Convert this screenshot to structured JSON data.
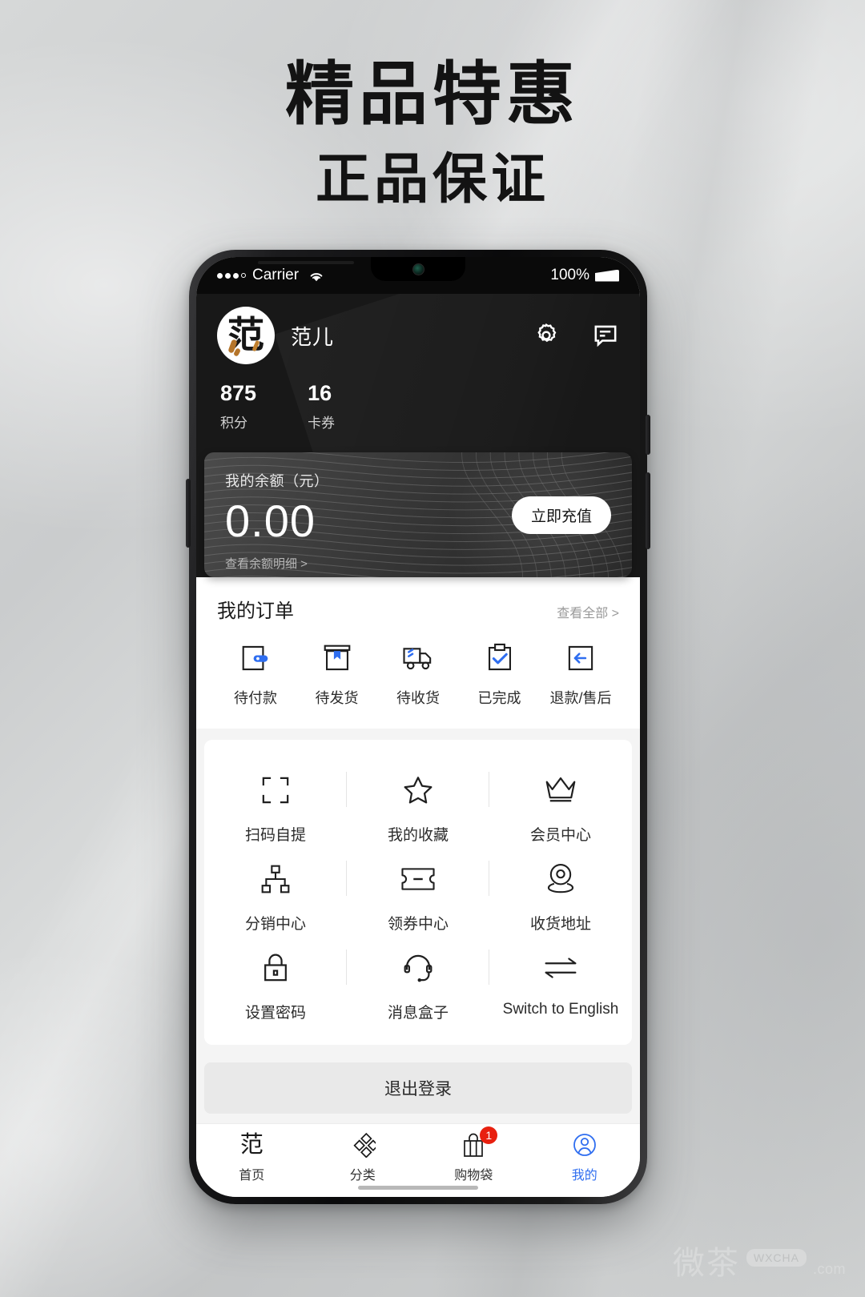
{
  "poster": {
    "headline_line1": "精品特惠",
    "headline_line2": "正品保证"
  },
  "status_bar": {
    "carrier": "Carrier",
    "battery": "100%",
    "wifi_icon": "wifi-icon",
    "signal_icon": "signal-dots-icon",
    "battery_icon": "battery-icon"
  },
  "profile": {
    "avatar_glyph": "范",
    "avatar_icon": "avatar",
    "username": "范儿",
    "settings_icon": "gear-icon",
    "message_icon": "message-icon",
    "stats": [
      {
        "value": "875",
        "label": "积分"
      },
      {
        "value": "16",
        "label": "卡券"
      }
    ]
  },
  "balance": {
    "label": "我的余额（元）",
    "amount": "0.00",
    "detail_link": "查看余额明细 >",
    "recharge_label": "立即充值"
  },
  "orders": {
    "title": "我的订单",
    "view_all": "查看全部 >",
    "items": [
      {
        "label": "待付款",
        "icon": "wallet-icon"
      },
      {
        "label": "待发货",
        "icon": "package-icon"
      },
      {
        "label": "待收货",
        "icon": "truck-icon"
      },
      {
        "label": "已完成",
        "icon": "clipboard-check-icon"
      },
      {
        "label": "退款/售后",
        "icon": "return-arrow-icon"
      }
    ]
  },
  "grid": {
    "rows": [
      [
        {
          "label": "扫码自提",
          "icon": "scan-icon"
        },
        {
          "label": "我的收藏",
          "icon": "star-icon"
        },
        {
          "label": "会员中心",
          "icon": "crown-icon"
        }
      ],
      [
        {
          "label": "分销中心",
          "icon": "network-icon"
        },
        {
          "label": "领券中心",
          "icon": "ticket-icon"
        },
        {
          "label": "收货地址",
          "icon": "location-pin-icon"
        }
      ],
      [
        {
          "label": "设置密码",
          "icon": "lock-icon"
        },
        {
          "label": "消息盒子",
          "icon": "headset-icon"
        },
        {
          "label": "Switch to English",
          "icon": "swap-arrows-icon"
        }
      ]
    ]
  },
  "logout": {
    "label": "退出登录"
  },
  "tab_bar": {
    "active_color": "#2f6ef0",
    "tabs": [
      {
        "label": "首页",
        "icon": "home-brand-icon",
        "glyph": "范",
        "badge": "",
        "active": false
      },
      {
        "label": "分类",
        "icon": "categories-icon",
        "badge": "",
        "active": false
      },
      {
        "label": "购物袋",
        "icon": "shopping-bag-icon",
        "badge": "1",
        "active": false
      },
      {
        "label": "我的",
        "icon": "user-icon",
        "badge": "",
        "active": true
      }
    ]
  },
  "watermark": {
    "cn": "微茶",
    "badge": "WXCHA",
    "domain": ".com"
  }
}
